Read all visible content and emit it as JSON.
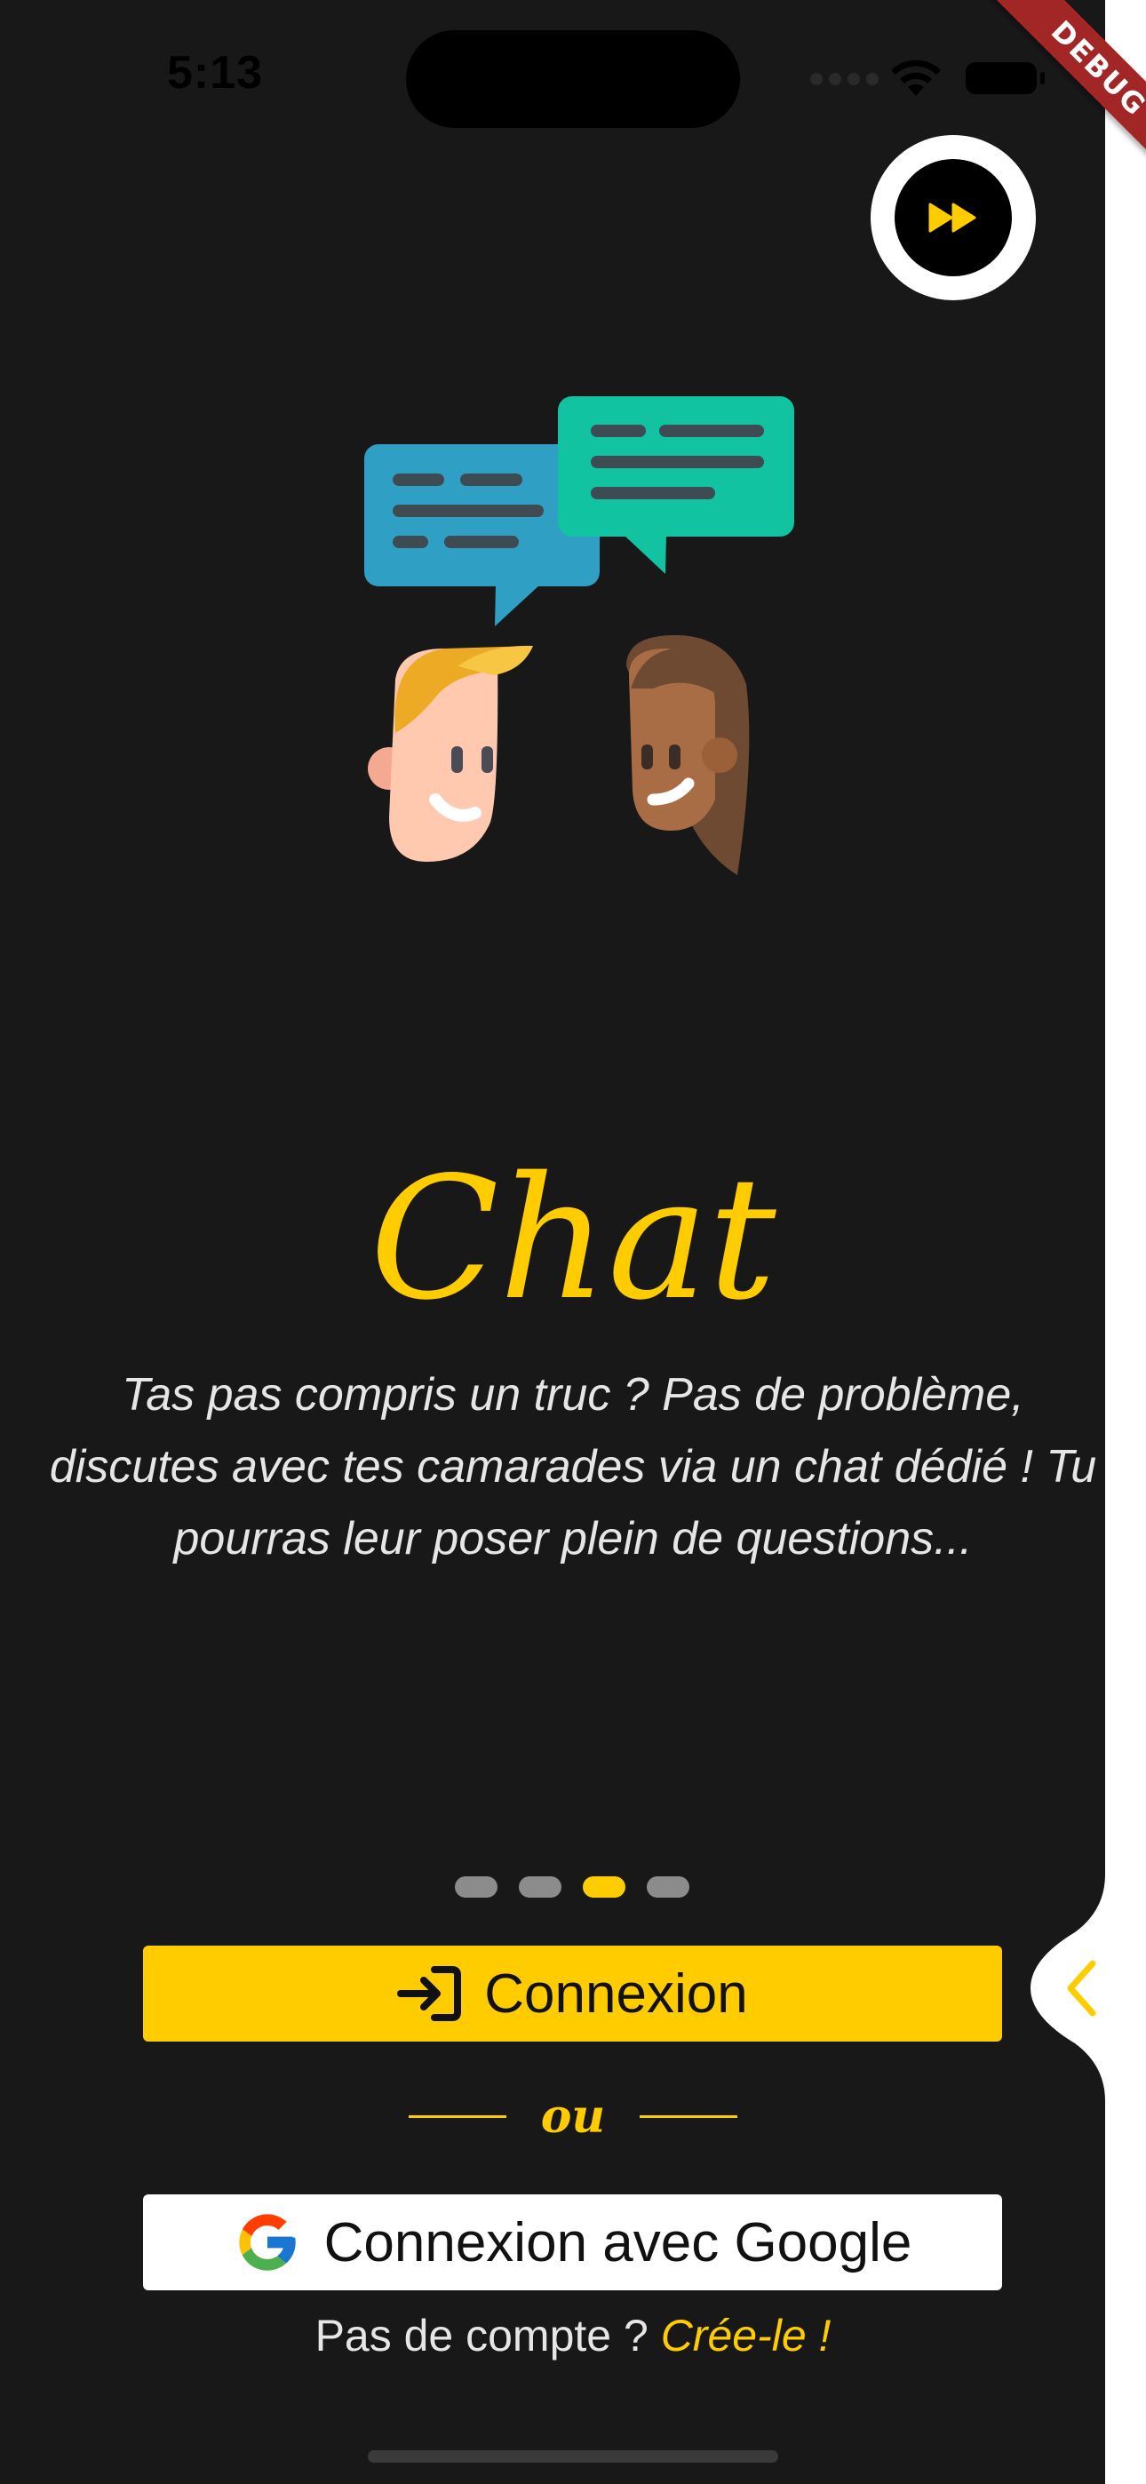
{
  "status_bar": {
    "time": "5:13"
  },
  "debug_banner": "DEBUG",
  "onboarding": {
    "title": "Chat",
    "description": "Tas pas compris un truc ? Pas de problème, discutes avec tes camarades via un chat dédié ! Tu pourras leur poser plein de questions...",
    "page_count": 4,
    "active_page": 3
  },
  "actions": {
    "login_label": "Connexion",
    "or_label": "ou",
    "google_label": "Connexion avec Google",
    "signup_prompt": "Pas de compte ?",
    "signup_link": "Crée-le !"
  },
  "icons": {
    "skip": "fast-forward-icon",
    "login": "login-arrow-icon",
    "google": "google-icon",
    "side_tab": "chevron-left-icon"
  },
  "colors": {
    "background": "#181818",
    "accent": "#ffcc00",
    "google_button": "#ffffff",
    "debug_ribbon": "#a32626"
  }
}
